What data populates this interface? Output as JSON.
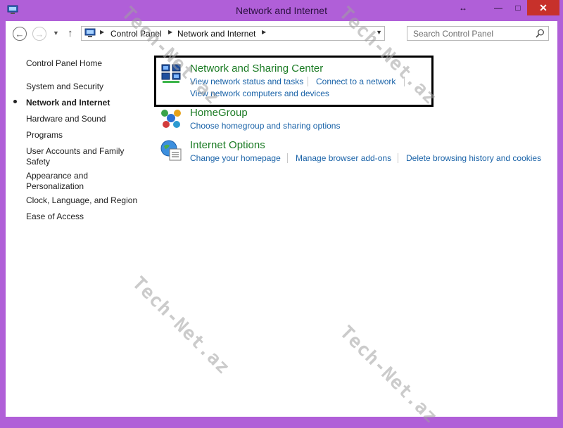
{
  "window": {
    "title": "Network and Internet",
    "resize_glyph": "↔",
    "minimize_glyph": "—",
    "maximize_glyph": "□",
    "close_glyph": "✕"
  },
  "nav": {
    "back_glyph": "←",
    "forward_glyph": "→",
    "dropdown_glyph": "▼",
    "up_glyph": "↑"
  },
  "address": {
    "crumbs": [
      "Control Panel",
      "Network and Internet"
    ],
    "sep_glyph": "▶",
    "drop_glyph": "▼"
  },
  "search": {
    "placeholder": "Search Control Panel"
  },
  "sidebar": {
    "home": "Control Panel Home",
    "items": [
      {
        "label": "System and Security",
        "active": false
      },
      {
        "label": "Network and Internet",
        "active": true
      },
      {
        "label": "Hardware and Sound",
        "active": false
      },
      {
        "label": "Programs",
        "active": false
      },
      {
        "label": "User Accounts and Family Safety",
        "active": false
      },
      {
        "label": "Appearance and Personalization",
        "active": false
      },
      {
        "label": "Clock, Language, and Region",
        "active": false
      },
      {
        "label": "Ease of Access",
        "active": false
      }
    ]
  },
  "categories": [
    {
      "title": "Network and Sharing Center",
      "icon": "network-sharing-icon",
      "links": [
        "View network status and tasks",
        "Connect to a network",
        "View network computers and devices"
      ]
    },
    {
      "title": "HomeGroup",
      "icon": "homegroup-icon",
      "links": [
        "Choose homegroup and sharing options"
      ]
    },
    {
      "title": "Internet Options",
      "icon": "internet-options-icon",
      "links": [
        "Change your homepage",
        "Manage browser add-ons",
        "Delete browsing history and cookies"
      ]
    }
  ],
  "watermark": "Tech-Net.az",
  "colors": {
    "frame": "#b05fd8",
    "close": "#c7312b",
    "category_title": "#1b7b24",
    "link": "#1a63a8"
  }
}
